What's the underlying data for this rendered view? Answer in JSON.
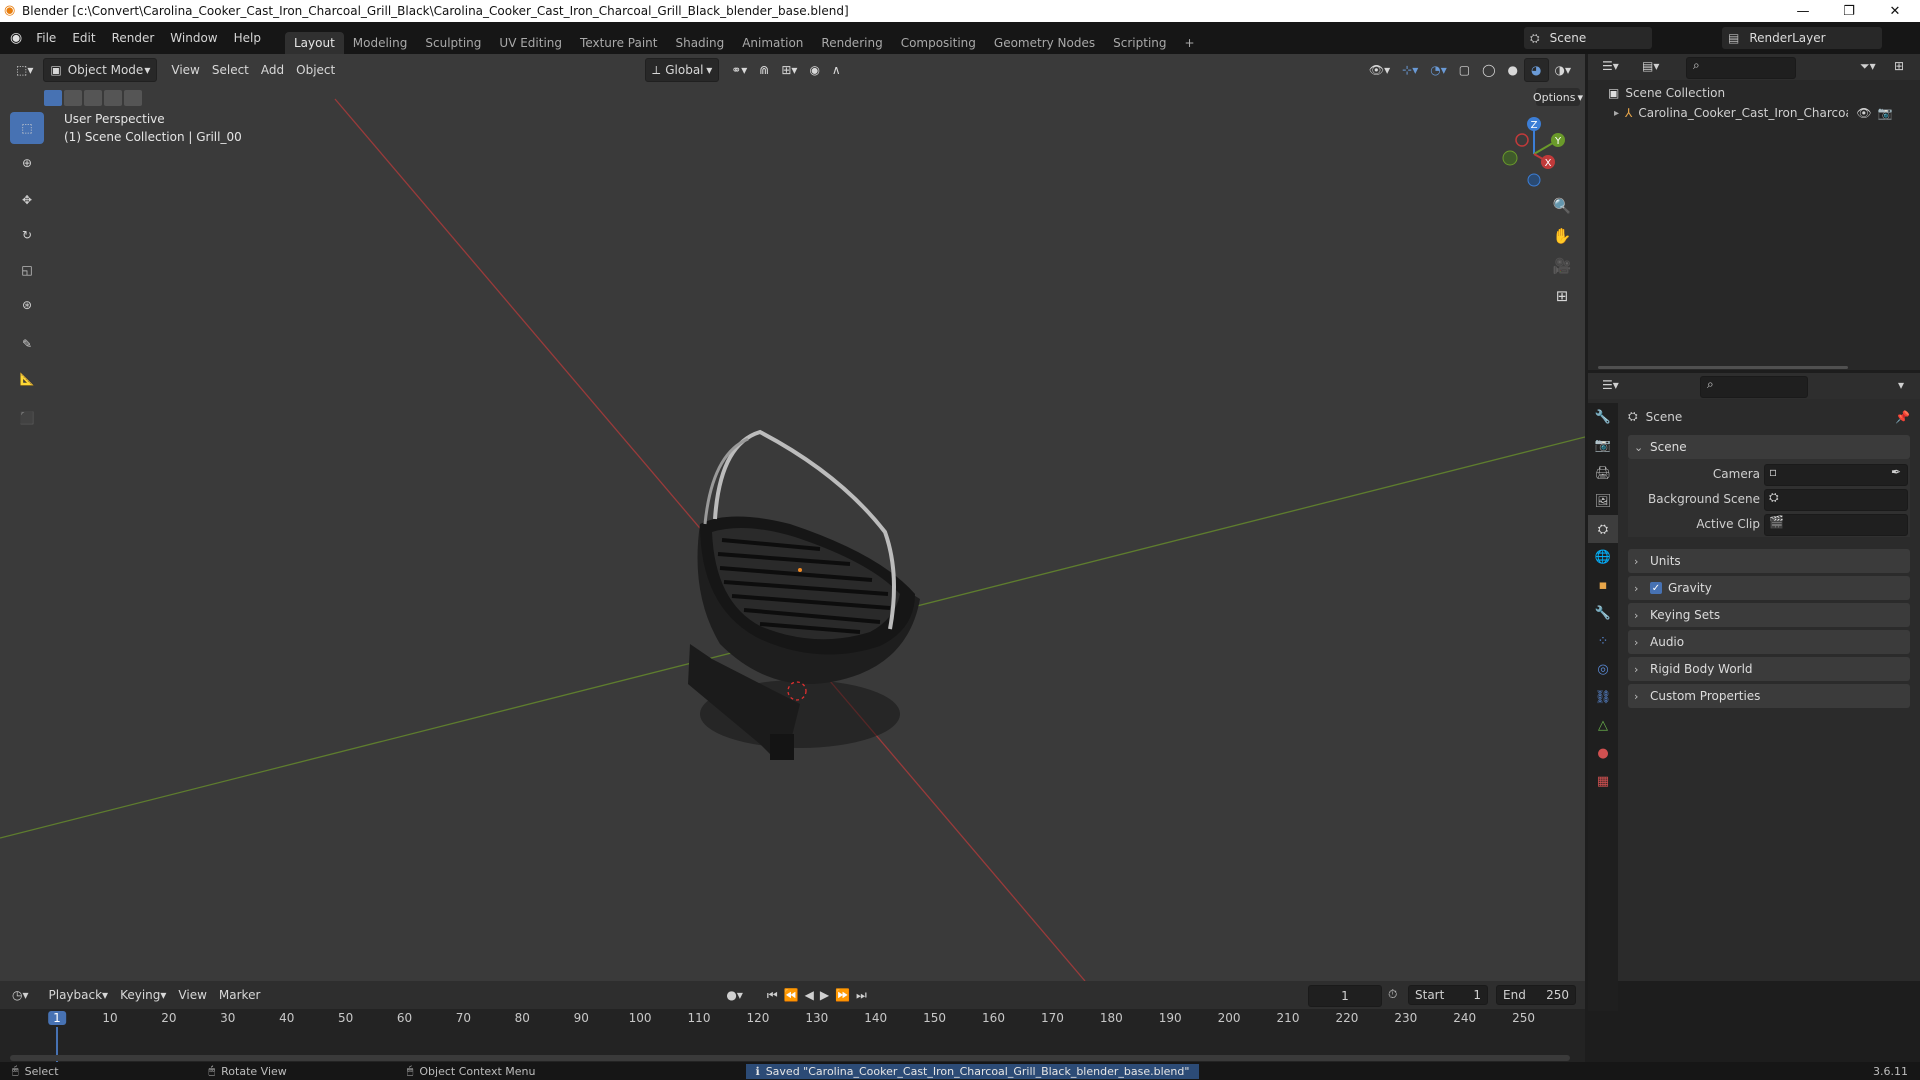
{
  "title_bar": {
    "title": "Blender [c:\\Convert\\Carolina_Cooker_Cast_Iron_Charcoal_Grill_Black\\Carolina_Cooker_Cast_Iron_Charcoal_Grill_Black_blender_base.blend]",
    "minimize": "—",
    "maximize": "❐",
    "close": "✕"
  },
  "menu": [
    "File",
    "Edit",
    "Render",
    "Window",
    "Help"
  ],
  "workspaces": [
    "Layout",
    "Modeling",
    "Sculpting",
    "UV Editing",
    "Texture Paint",
    "Shading",
    "Animation",
    "Rendering",
    "Compositing",
    "Geometry Nodes",
    "Scripting",
    "+"
  ],
  "active_workspace": "Layout",
  "scene_selector": "Scene",
  "renderlayer_selector": "RenderLayer",
  "viewport_header": {
    "mode": "Object Mode",
    "menus": [
      "View",
      "Select",
      "Add",
      "Object"
    ],
    "orientation": "Global",
    "options": "Options"
  },
  "viewport_overlay": {
    "line1": "User Perspective",
    "line2": "(1) Scene Collection | Grill_00"
  },
  "gizmo": {
    "x": "X",
    "y": "Y",
    "z": "Z"
  },
  "outliner": {
    "root": "Scene Collection",
    "items": [
      "Carolina_Cooker_Cast_Iron_Charcoal_Gr"
    ]
  },
  "properties": {
    "header": "Scene",
    "panel_scene": "Scene",
    "camera_label": "Camera",
    "background_label": "Background Scene",
    "clip_label": "Active Clip",
    "panels": [
      {
        "label": "Units",
        "checkbox": false
      },
      {
        "label": "Gravity",
        "checkbox": true
      },
      {
        "label": "Keying Sets",
        "checkbox": false
      },
      {
        "label": "Audio",
        "checkbox": false
      },
      {
        "label": "Rigid Body World",
        "checkbox": false
      },
      {
        "label": "Custom Properties",
        "checkbox": false
      }
    ]
  },
  "timeline": {
    "menus": [
      "Playback",
      "Keying",
      "View",
      "Marker"
    ],
    "current_frame": "1",
    "start_label": "Start",
    "start": "1",
    "end_label": "End",
    "end": "250",
    "ticks": [
      "1",
      "10",
      "20",
      "30",
      "40",
      "50",
      "60",
      "70",
      "80",
      "90",
      "100",
      "110",
      "120",
      "130",
      "140",
      "150",
      "160",
      "170",
      "180",
      "190",
      "200",
      "210",
      "220",
      "230",
      "240",
      "250"
    ]
  },
  "status_bar": {
    "select": "Select",
    "rotate": "Rotate View",
    "context": "Object Context Menu",
    "message": "Saved \"Carolina_Cooker_Cast_Iron_Charcoal_Grill_Black_blender_base.blend\"",
    "version": "3.6.11"
  },
  "colors": {
    "accent": "#4772b3",
    "x_axis": "#c03a3a",
    "y_axis": "#6a9a2a",
    "z_axis": "#3c7ed6"
  }
}
